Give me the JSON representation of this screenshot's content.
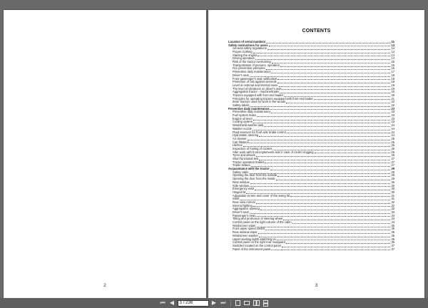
{
  "pages": {
    "left_number": "2",
    "right_number": "3"
  },
  "toc": {
    "title": "CONTENTS",
    "entries": [
      {
        "label": "Location of serial numbers",
        "page": "11",
        "type": "section"
      },
      {
        "label": "Safety instructions for users",
        "page": "13",
        "type": "section"
      },
      {
        "label": "General safety regulations",
        "page": "14",
        "type": "sub"
      },
      {
        "label": "Proper clothing",
        "page": "14",
        "type": "sub"
      },
      {
        "label": "Starting the engine",
        "page": "14",
        "type": "sub"
      },
      {
        "label": "Driving operation",
        "page": "14",
        "type": "sub"
      },
      {
        "label": "Risk of the tractor overturning",
        "page": "15",
        "type": "sub"
      },
      {
        "label": "Transportation of persons, operation",
        "page": "15",
        "type": "sub"
      },
      {
        "label": "Fire prevention principles",
        "page": "16",
        "type": "sub"
      },
      {
        "label": "Preventive daily maintenance",
        "page": "17",
        "type": "sub"
      },
      {
        "label": "Driver's seat",
        "page": "18",
        "type": "sub"
      },
      {
        "label": "Front passenger's seat notification",
        "page": "18",
        "type": "sub"
      },
      {
        "label": "Protection of cab against aerosols",
        "page": "18",
        "type": "sub"
      },
      {
        "label": "Level of external and internal noise",
        "page": "19",
        "type": "sub"
      },
      {
        "label": "The level of vibrations on driver's seat",
        "page": "19",
        "type": "sub"
      },
      {
        "label": "Aggregation tractor - machine/trailer",
        "page": "20",
        "type": "sub"
      },
      {
        "label": "Tractors equipped with front end loader",
        "page": "20",
        "type": "sub"
      },
      {
        "label": "Principles for operating tractors equipped with front end loader",
        "page": "21",
        "type": "sub"
      },
      {
        "label": "Zetor tractors used for work in the woods",
        "page": "22",
        "type": "sub"
      },
      {
        "label": "Safety labels",
        "page": "22",
        "type": "sub"
      },
      {
        "label": "Preventive daily maintenance",
        "page": "23",
        "type": "section"
      },
      {
        "label": "Preventive daily maintenance",
        "page": "23",
        "type": "sub"
      },
      {
        "label": "Fuel system leaks",
        "page": "23",
        "type": "sub"
      },
      {
        "label": "Engine oil level",
        "page": "23",
        "type": "sub"
      },
      {
        "label": "Cooling system",
        "page": "23",
        "type": "sub"
      },
      {
        "label": "Windshield washer tank",
        "page": "24",
        "type": "sub"
      },
      {
        "label": "Washer nozzle",
        "page": "24",
        "type": "sub"
      },
      {
        "label": "Fluid reservoir for front axle brake control",
        "page": "24",
        "type": "sub"
      },
      {
        "label": "Hydrostatic steering",
        "page": "24",
        "type": "sub"
      },
      {
        "label": "Air cleaner",
        "page": "25",
        "type": "sub"
      },
      {
        "label": "Cab filtration",
        "page": "25",
        "type": "sub"
      },
      {
        "label": "Hitches",
        "page": "26",
        "type": "sub"
      },
      {
        "label": "Inspection of fouling of coolers",
        "page": "26",
        "type": "sub"
      },
      {
        "label": "After work with front implements and in case of cooler clogging",
        "page": "26",
        "type": "sub"
      },
      {
        "label": "Tyres and wheels",
        "page": "26",
        "type": "sub"
      },
      {
        "label": "Short functional test",
        "page": "27",
        "type": "sub"
      },
      {
        "label": "Tractor operation brakes",
        "page": "27",
        "type": "sub"
      },
      {
        "label": "Trailer brakes",
        "page": "27",
        "type": "sub"
      },
      {
        "label": "Acquaintance with the tractor",
        "page": "29",
        "type": "section"
      },
      {
        "label": "Safety cabin",
        "page": "29",
        "type": "sub"
      },
      {
        "label": "Opening the door from the outside",
        "page": "29",
        "type": "sub"
      },
      {
        "label": "Opening the door from the inside",
        "page": "29",
        "type": "sub"
      },
      {
        "label": "Rear window",
        "page": "30",
        "type": "sub"
      },
      {
        "label": "Side window",
        "page": "30",
        "type": "sub"
      },
      {
        "label": "Emergency exits",
        "page": "30",
        "type": "sub"
      },
      {
        "label": "Hinged lid",
        "page": "30",
        "type": "sub"
      },
      {
        "label": "Adjustable screen and cover of the swing lid",
        "page": "31",
        "type": "sub"
      },
      {
        "label": "Shelf",
        "page": "31",
        "type": "sub"
      },
      {
        "label": "Rear view mirrors",
        "page": "32",
        "type": "sub"
      },
      {
        "label": "Internal lighting",
        "page": "32",
        "type": "sub"
      },
      {
        "label": "Aggregation opening",
        "page": "32",
        "type": "sub"
      },
      {
        "label": "Driver's seat",
        "page": "33",
        "type": "sub"
      },
      {
        "label": "Passenger's seat",
        "page": "34",
        "type": "sub"
      },
      {
        "label": "Tilting and protrusion of steering wheel",
        "page": "34",
        "type": "sub"
      },
      {
        "label": "Control panel on the right column of the cabin",
        "page": "34",
        "type": "sub"
      },
      {
        "label": "Windscreen wiper",
        "page": "35",
        "type": "sub"
      },
      {
        "label": "Front wiper speed switch",
        "page": "35",
        "type": "sub"
      },
      {
        "label": "Rear window wiper",
        "page": "35",
        "type": "sub"
      },
      {
        "label": "Windscreen washer",
        "page": "35",
        "type": "sub"
      },
      {
        "label": "Upper working lights switching on",
        "page": "36",
        "type": "sub"
      },
      {
        "label": "Control panel on the right rear mudguard",
        "page": "36",
        "type": "sub"
      },
      {
        "label": "Switches located on the control panel",
        "page": "37",
        "type": "sub"
      },
      {
        "label": "Panel of the instrument panel",
        "page": "37",
        "type": "sub"
      }
    ]
  },
  "toolbar": {
    "page_value": "3",
    "page_total": "/ 236",
    "icons": [
      "first-page-icon",
      "prev-page-icon",
      "next-page-icon",
      "last-page-icon",
      "fit-page-icon",
      "fit-width-icon",
      "two-page-icon",
      "continuous-icon"
    ]
  }
}
